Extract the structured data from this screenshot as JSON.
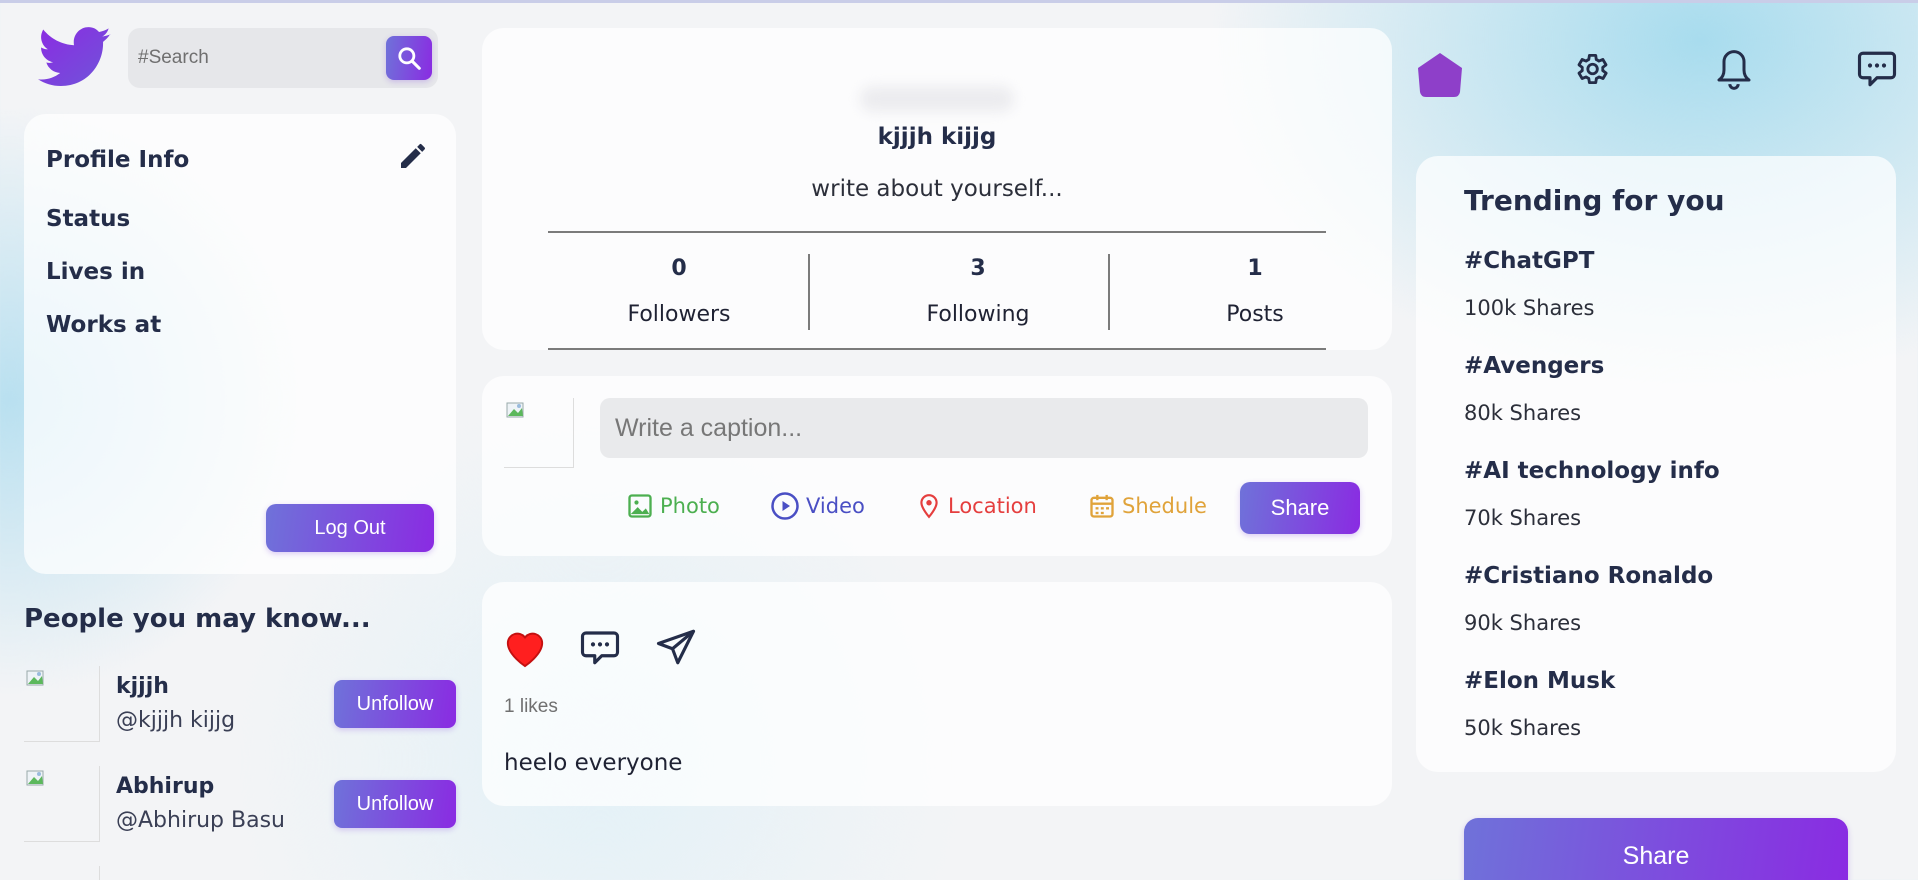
{
  "search": {
    "placeholder": "#Search"
  },
  "profile_info": {
    "title": "Profile Info",
    "rows": [
      "Status",
      "Lives in",
      "Works at"
    ],
    "logout_label": "Log Out"
  },
  "people": {
    "title": "People you may know...",
    "items": [
      {
        "name": "kjjjh",
        "handle": "@kjjjh kijjg",
        "button": "Unfollow"
      },
      {
        "name": "Abhirup",
        "handle": "@Abhirup Basu",
        "button": "Unfollow"
      }
    ]
  },
  "profile": {
    "name": "kjjjh kijjg",
    "bio": "write about yourself...",
    "stats": [
      {
        "value": "0",
        "label": "Followers"
      },
      {
        "value": "3",
        "label": "Following"
      },
      {
        "value": "1",
        "label": "Posts"
      }
    ]
  },
  "composer": {
    "placeholder": "Write a caption...",
    "options": [
      {
        "label": "Photo",
        "icon": "photo-icon",
        "color": "#4caf50"
      },
      {
        "label": "Video",
        "icon": "play-circle-icon",
        "color": "#4a4fc4"
      },
      {
        "label": "Location",
        "icon": "map-pin-icon",
        "color": "#e53e3e"
      },
      {
        "label": "Shedule",
        "icon": "calendar-icon",
        "color": "#e0a33a"
      }
    ],
    "share_label": "Share"
  },
  "post": {
    "likes_text": "1 likes",
    "description": "heelo everyone"
  },
  "trending": {
    "title": "Trending for you",
    "items": [
      {
        "tag": "#ChatGPT",
        "shares": "100k Shares"
      },
      {
        "tag": "#Avengers",
        "shares": "80k Shares"
      },
      {
        "tag": "#AI technology info",
        "shares": "70k Shares"
      },
      {
        "tag": "#Cristiano Ronaldo",
        "shares": "90k Shares"
      },
      {
        "tag": "#Elon Musk",
        "shares": "50k Shares"
      }
    ],
    "share_label": "Share"
  },
  "colors": {
    "accent_start": "#6f72d9",
    "accent_end": "#8a2be2",
    "text": "#242d49",
    "like": "#ff1f1f"
  }
}
